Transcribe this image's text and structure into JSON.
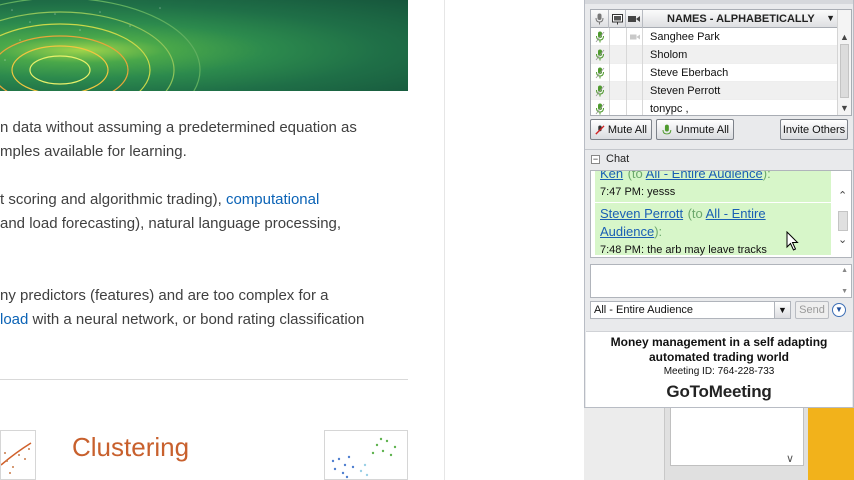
{
  "webpage": {
    "para1": {
      "text": "n data without assuming a predetermined equation as"
    },
    "para2": {
      "text": "mples available for learning."
    },
    "para3": {
      "pre": "t scoring and algorithmic trading), ",
      "link": "computational"
    },
    "para4": {
      "text": "and load forecasting), natural language processing,"
    },
    "para5": {
      "text": "ny predictors (features) and are too complex for a"
    },
    "para6": {
      "link": "load",
      "post": " with a neural network, or bond rating classification"
    },
    "section_title": "Clustering"
  },
  "attendees": {
    "header": "NAMES - ALPHABETICALLY",
    "rows": [
      {
        "name": "Sanghee Park"
      },
      {
        "name": "Sholom"
      },
      {
        "name": "Steve Eberbach"
      },
      {
        "name": "Steven Perrott"
      },
      {
        "name": "tonypc ,"
      }
    ]
  },
  "buttons": {
    "mute_all": "Mute All",
    "unmute_all": "Unmute All",
    "invite_others": "Invite Others"
  },
  "chat": {
    "header": "Chat",
    "messages": [
      {
        "who": "Ken",
        "to_prefix": "(to ",
        "to": "All - Entire Audience",
        "to_suffix": "):",
        "line": "7:47 PM: yesss"
      },
      {
        "who": "Steven Perrott",
        "to_prefix": "(to ",
        "to": "All - Entire Audience",
        "to_suffix": "):",
        "line": "7:48 PM: the arb may leave tracks"
      }
    ],
    "recipient": "All - Entire Audience",
    "send": "Send"
  },
  "footer": {
    "title": "Money management in a self adapting automated trading world",
    "meeting_id": "Meeting ID: 764-228-733",
    "logo": "GoToMeeting"
  },
  "colors": {
    "accent_link": "#1a5fb4",
    "chat_bubble": "#d7f6c9",
    "clustering": "#c8602d"
  }
}
